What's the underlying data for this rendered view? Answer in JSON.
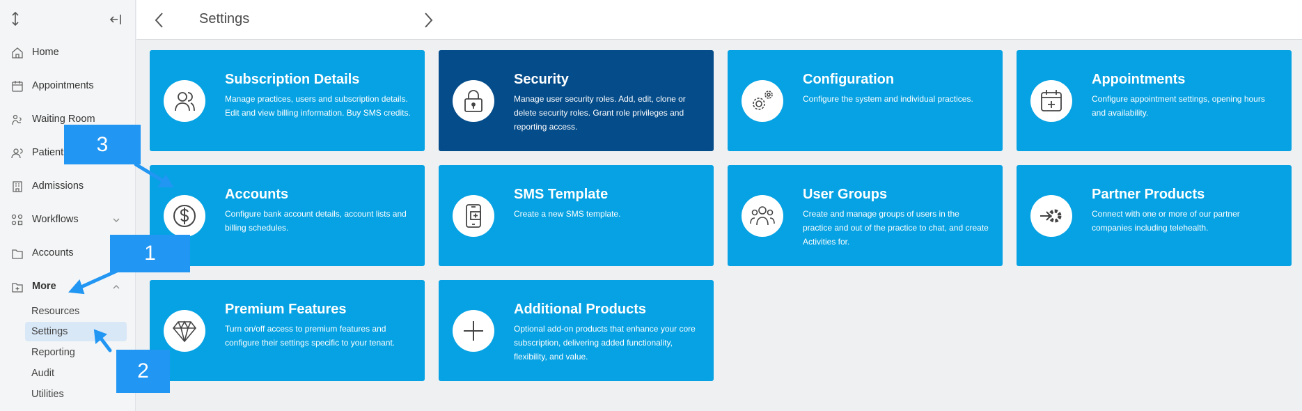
{
  "header": {
    "title": "Settings"
  },
  "sidebar": {
    "items": [
      {
        "label": "Home",
        "icon": "home-icon"
      },
      {
        "label": "Appointments",
        "icon": "calendar-icon"
      },
      {
        "label": "Waiting Room",
        "icon": "waiting-room-icon"
      },
      {
        "label": "Patients",
        "icon": "patients-icon"
      },
      {
        "label": "Admissions",
        "icon": "admissions-icon"
      },
      {
        "label": "Workflows",
        "icon": "workflows-icon"
      },
      {
        "label": "Accounts",
        "icon": "folder-icon"
      },
      {
        "label": "More",
        "icon": "folder-plus-icon"
      }
    ],
    "more_sub": [
      {
        "label": "Resources"
      },
      {
        "label": "Settings",
        "active": true
      },
      {
        "label": "Reporting"
      },
      {
        "label": "Audit"
      },
      {
        "label": "Utilities"
      }
    ]
  },
  "cards": [
    {
      "title": "Subscription Details",
      "desc": "Manage practices, users and subscription details. Edit and view billing information. Buy SMS credits.",
      "icon": "users-icon"
    },
    {
      "title": "Security",
      "desc": "Manage user security roles. Add, edit, clone or delete security roles. Grant role privileges and reporting access.",
      "icon": "lock-icon"
    },
    {
      "title": "Configuration",
      "desc": "Configure the system and individual practices.",
      "icon": "gears-icon"
    },
    {
      "title": "Appointments",
      "desc": "Configure appointment settings, opening hours and availability.",
      "icon": "calendar-plus-icon"
    },
    {
      "title": "Accounts",
      "desc": "Configure bank account details, account lists and billing schedules.",
      "icon": "dollar-icon"
    },
    {
      "title": "SMS Template",
      "desc": "Create a new SMS template.",
      "icon": "phone-icon"
    },
    {
      "title": "User Groups",
      "desc": "Create and manage groups of users in the practice and out of the practice to chat, and create Activities for.",
      "icon": "user-group-icon"
    },
    {
      "title": "Partner Products",
      "desc": "Connect with one or more of our partner companies including telehealth.",
      "icon": "partner-icon"
    },
    {
      "title": "Premium Features",
      "desc": "Turn on/off access to premium features and configure their settings specific to your tenant.",
      "icon": "diamond-icon"
    },
    {
      "title": "Additional Products",
      "desc": "Optional add-on products that enhance your core subscription, delivering added functionality, flexibility, and value.",
      "icon": "plus-icon"
    }
  ],
  "callouts": [
    {
      "label": "1"
    },
    {
      "label": "2"
    },
    {
      "label": "3"
    }
  ],
  "colors": {
    "card": "#06a2e3",
    "card_active": "#054c8a",
    "callout": "#2196f3"
  }
}
